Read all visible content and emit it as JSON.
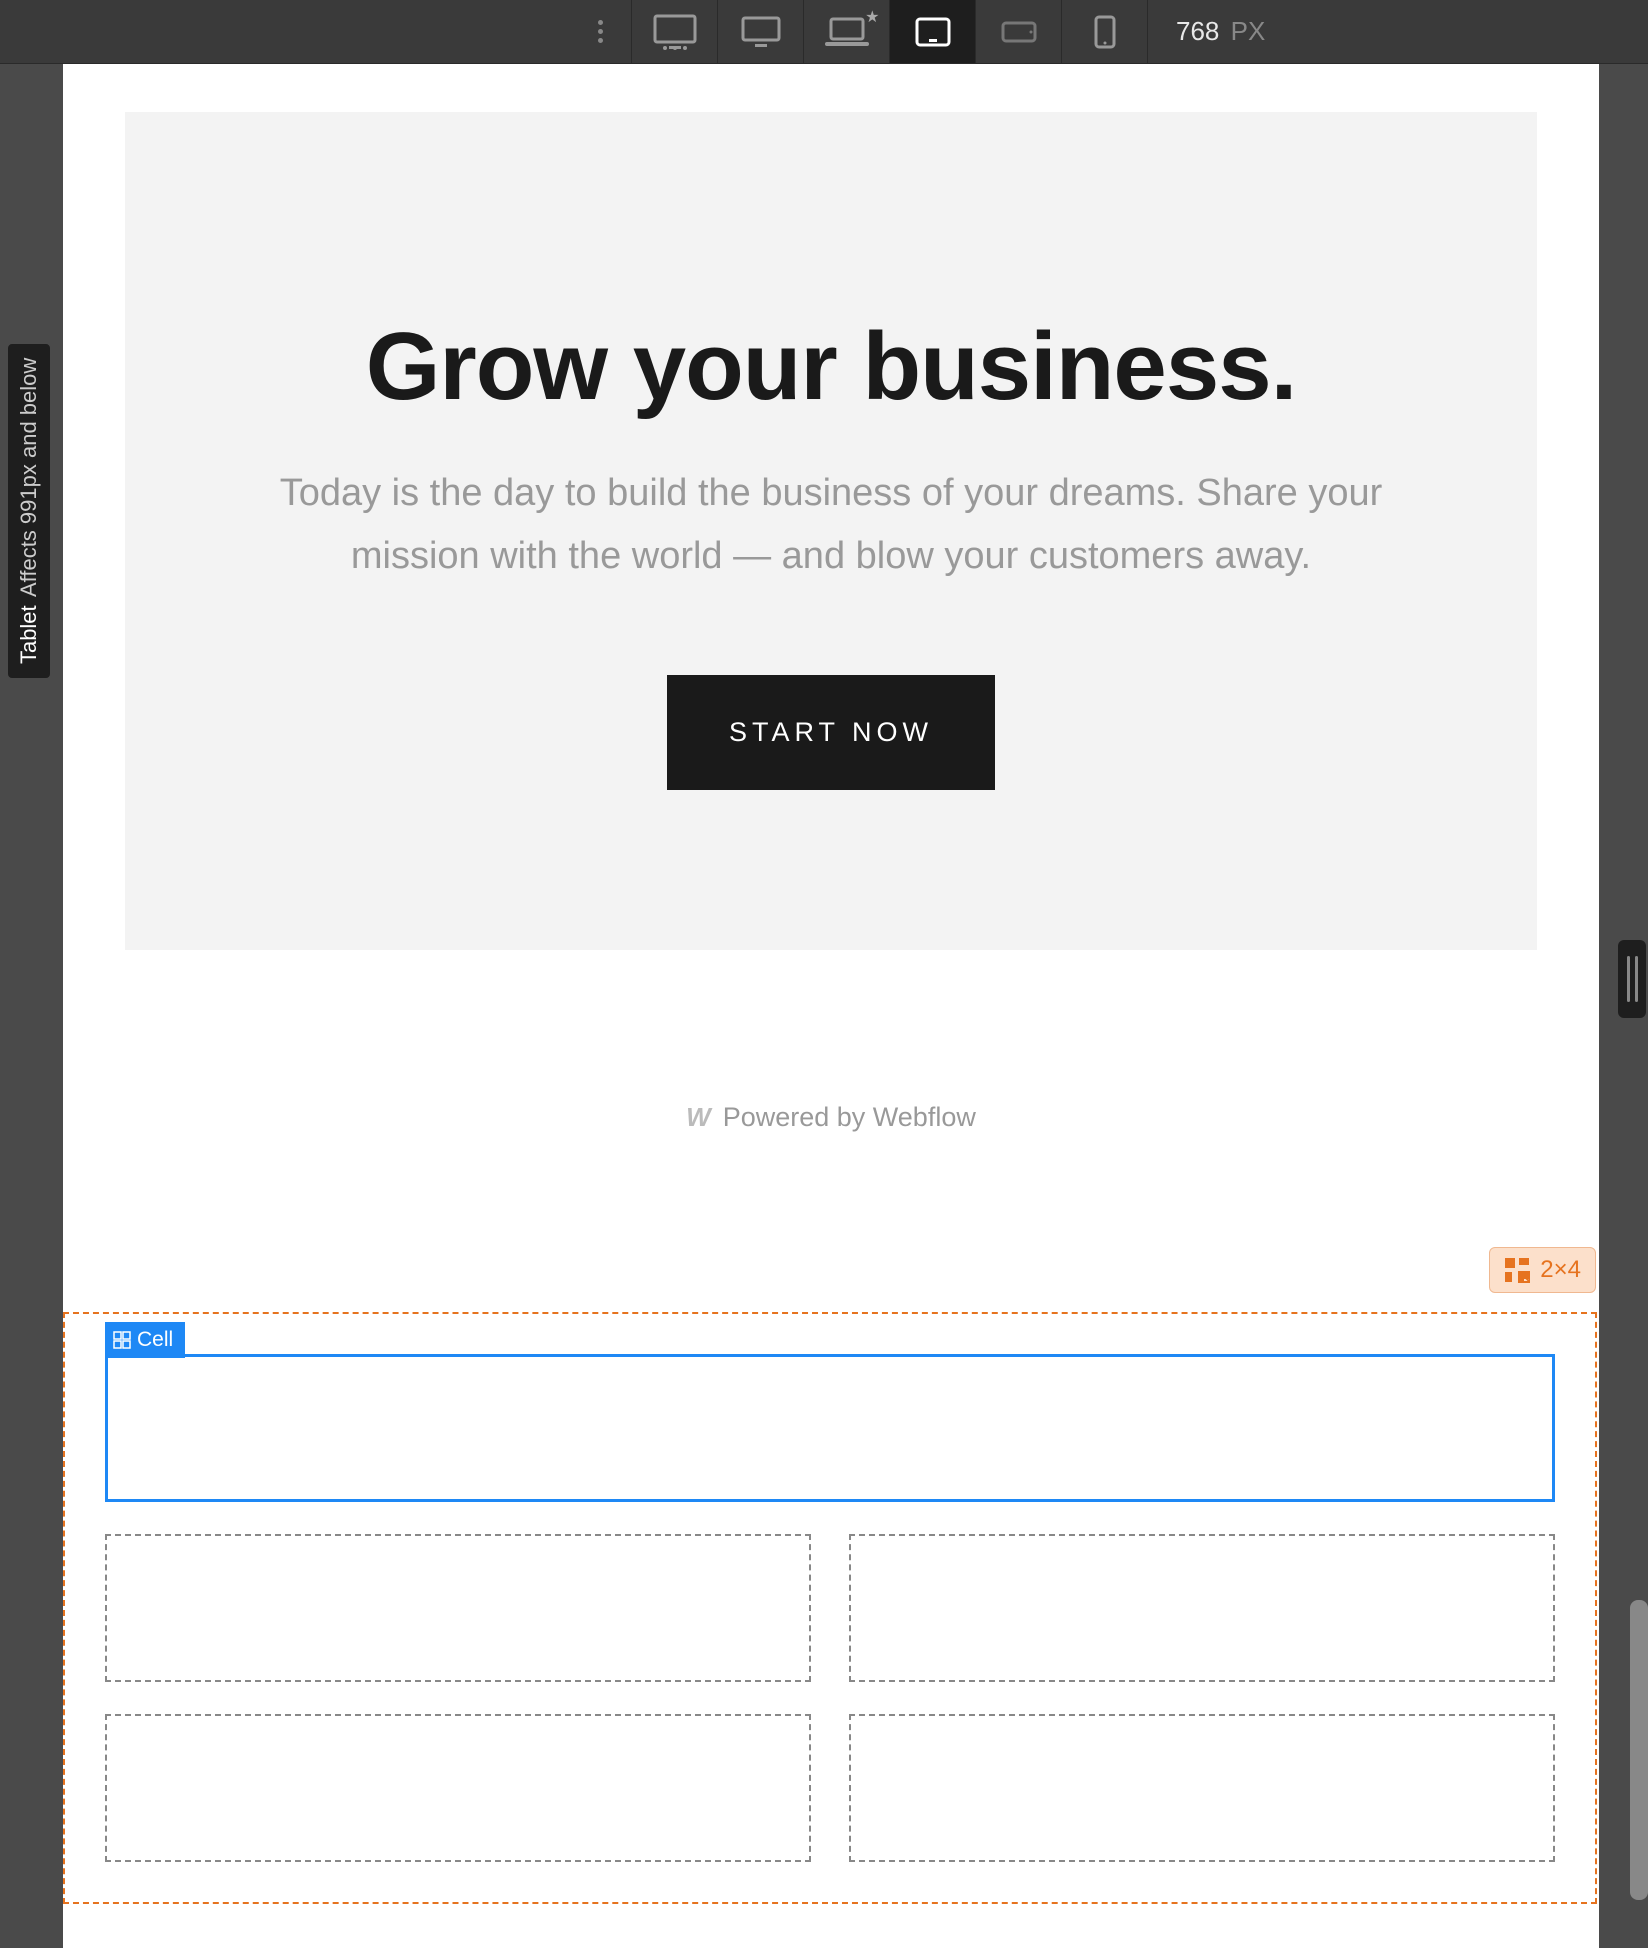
{
  "toolbar": {
    "width_value": "768",
    "width_unit": "PX"
  },
  "indicator": {
    "label_primary": "Tablet",
    "label_secondary": "Affects 991px and below"
  },
  "hero": {
    "title": "Grow your business.",
    "subtitle": "Today is the day to build the business of your dreams. Share your mission with the world — and blow your customers away.",
    "cta_label": "START NOW"
  },
  "footer": {
    "text": "Powered by Webflow"
  },
  "grid": {
    "badge_text": "2×4",
    "cell_label": "Cell"
  }
}
